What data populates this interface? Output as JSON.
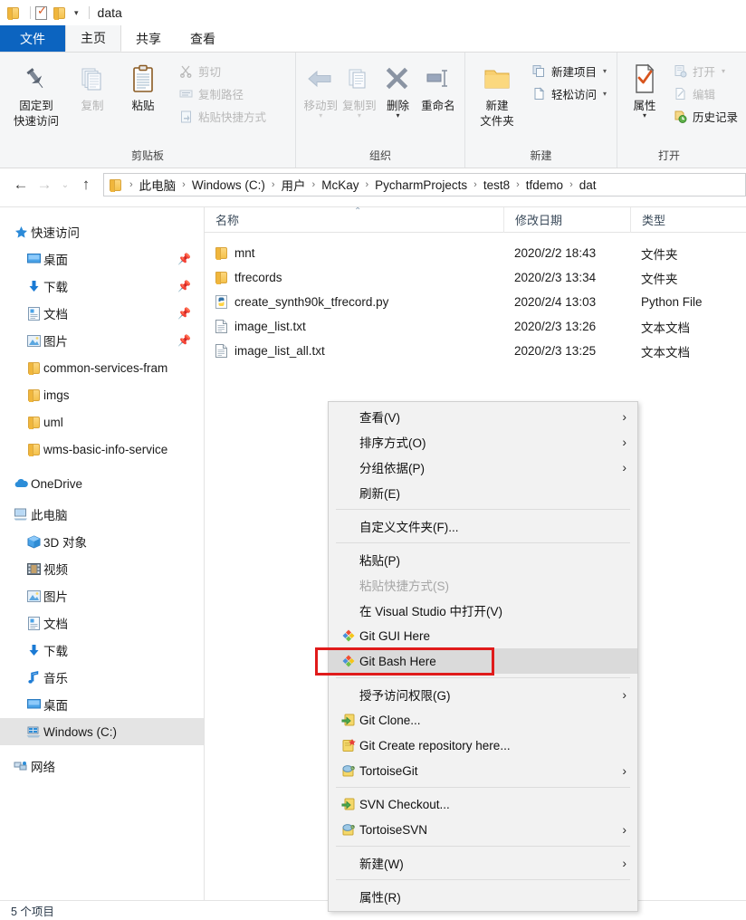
{
  "window": {
    "title": "data",
    "quick_access_icons": [
      "folder-icon",
      "properties-check-icon",
      "folder-icon"
    ],
    "dropdown_caret": "▾"
  },
  "ribbon": {
    "tabs": [
      {
        "label": "文件",
        "state": "file"
      },
      {
        "label": "主页",
        "state": "active"
      },
      {
        "label": "共享",
        "state": "normal"
      },
      {
        "label": "查看",
        "state": "normal"
      }
    ],
    "groups": [
      {
        "title": "剪贴板",
        "big_buttons": [
          {
            "label": "固定到\n快速访问",
            "line1": "固定到",
            "line2": "快速访问",
            "icon": "pin-icon"
          },
          {
            "label": "复制",
            "line1": "复制",
            "line2": "",
            "icon": "copy-icon",
            "dim": true
          },
          {
            "label": "粘贴",
            "line1": "粘贴",
            "line2": "",
            "icon": "paste-clipboard-icon"
          }
        ],
        "small_buttons": [
          {
            "label": "剪切",
            "icon": "scissors-icon",
            "dim": true
          },
          {
            "label": "复制路径",
            "icon": "copy-path-icon",
            "dim": true
          },
          {
            "label": "粘贴快捷方式",
            "icon": "paste-shortcut-icon",
            "dim": true
          }
        ]
      },
      {
        "title": "组织",
        "big_buttons": [
          {
            "line1": "移动到",
            "line2": "",
            "icon": "move-to-arrow-icon",
            "dim": true,
            "caret": "▾"
          },
          {
            "line1": "复制到",
            "line2": "",
            "icon": "copy-to-icon",
            "dim": true,
            "caret": "▾"
          },
          {
            "line1": "删除",
            "line2": "",
            "icon": "delete-x-icon",
            "caret": "▾"
          },
          {
            "line1": "重命名",
            "line2": "",
            "icon": "rename-icon"
          }
        ],
        "small_buttons": []
      },
      {
        "title": "新建",
        "big_buttons": [
          {
            "line1": "新建",
            "line2": "文件夹",
            "icon": "new-folder-icon"
          }
        ],
        "small_buttons": [
          {
            "label": "新建项目",
            "icon": "new-item-icon",
            "caret": "▾"
          },
          {
            "label": "轻松访问",
            "icon": "easy-access-icon",
            "caret": "▾"
          }
        ]
      },
      {
        "title": "打开",
        "big_buttons": [
          {
            "line1": "属性",
            "line2": "",
            "icon": "properties-check-icon",
            "caret": "▾"
          }
        ],
        "small_buttons": [
          {
            "label": "打开",
            "icon": "open-icon",
            "dim": true,
            "caret": "▾"
          },
          {
            "label": "编辑",
            "icon": "edit-icon",
            "dim": true
          },
          {
            "label": "历史记录",
            "icon": "history-icon"
          }
        ]
      }
    ]
  },
  "address_bar": {
    "back_icon": "arrow-left-icon",
    "forward_icon": "arrow-right-icon",
    "recent_icon": "chevron-down-icon",
    "up_icon": "arrow-up-icon",
    "breadcrumbs": [
      "此电脑",
      "Windows (C:)",
      "用户",
      "McKay",
      "PycharmProjects",
      "test8",
      "tfdemo",
      "dat"
    ],
    "separator": "›"
  },
  "sidebar": {
    "items": [
      {
        "label": "快速访问",
        "icon": "star-quick-access-icon",
        "level": 0,
        "chevron": "⌄",
        "pinned": false
      },
      {
        "label": "桌面",
        "icon": "desktop-icon",
        "level": 1,
        "pinned": true
      },
      {
        "label": "下载",
        "icon": "download-arrow-icon",
        "level": 1,
        "pinned": true
      },
      {
        "label": "文档",
        "icon": "documents-icon",
        "level": 1,
        "pinned": true
      },
      {
        "label": "图片",
        "icon": "pictures-icon",
        "level": 1,
        "pinned": true
      },
      {
        "label": "common-services-fram",
        "icon": "folder-icon",
        "level": 1,
        "pinned": false
      },
      {
        "label": "imgs",
        "icon": "folder-icon",
        "level": 1,
        "pinned": false
      },
      {
        "label": "uml",
        "icon": "folder-icon",
        "level": 1,
        "pinned": false
      },
      {
        "label": "wms-basic-info-service",
        "icon": "folder-icon",
        "level": 1,
        "pinned": false
      },
      {
        "label": "OneDrive",
        "icon": "onedrive-cloud-icon",
        "level": 0,
        "pinned": false
      },
      {
        "label": "此电脑",
        "icon": "this-pc-icon",
        "level": 0,
        "chevron": "⌄",
        "pinned": false
      },
      {
        "label": "3D 对象",
        "icon": "3d-objects-icon",
        "level": 1,
        "pinned": false
      },
      {
        "label": "视频",
        "icon": "videos-icon",
        "level": 1,
        "pinned": false
      },
      {
        "label": "图片",
        "icon": "pictures-icon",
        "level": 1,
        "pinned": false
      },
      {
        "label": "文档",
        "icon": "documents-icon",
        "level": 1,
        "pinned": false
      },
      {
        "label": "下载",
        "icon": "download-arrow-icon",
        "level": 1,
        "pinned": false
      },
      {
        "label": "音乐",
        "icon": "music-note-icon",
        "level": 1,
        "pinned": false
      },
      {
        "label": "桌面",
        "icon": "desktop-icon",
        "level": 1,
        "pinned": false
      },
      {
        "label": "Windows (C:)",
        "icon": "drive-icon",
        "level": 1,
        "pinned": false,
        "selected": true
      },
      {
        "label": "网络",
        "icon": "network-icon",
        "level": 0,
        "pinned": false
      }
    ]
  },
  "file_list": {
    "columns": [
      {
        "label": "名称",
        "sorted": true,
        "sort_indicator": "⌃"
      },
      {
        "label": "修改日期",
        "sorted": false
      },
      {
        "label": "类型",
        "sorted": false
      }
    ],
    "rows": [
      {
        "name": "mnt",
        "date": "2020/2/2 18:43",
        "type": "文件夹",
        "icon": "folder-icon"
      },
      {
        "name": "tfrecords",
        "date": "2020/2/3 13:34",
        "type": "文件夹",
        "icon": "folder-icon"
      },
      {
        "name": "create_synth90k_tfrecord.py",
        "date": "2020/2/4 13:03",
        "type": "Python File",
        "icon": "python-file-icon"
      },
      {
        "name": "image_list.txt",
        "date": "2020/2/3 13:26",
        "type": "文本文档",
        "icon": "text-file-icon"
      },
      {
        "name": "image_list_all.txt",
        "date": "2020/2/3 13:25",
        "type": "文本文档",
        "icon": "text-file-icon"
      }
    ]
  },
  "context_menu": {
    "items": [
      {
        "label": "查看(V)",
        "submenu": true,
        "icon": null
      },
      {
        "label": "排序方式(O)",
        "submenu": true,
        "icon": null
      },
      {
        "label": "分组依据(P)",
        "submenu": true,
        "icon": null
      },
      {
        "label": "刷新(E)",
        "submenu": false,
        "icon": null
      },
      {
        "separator": true
      },
      {
        "label": "自定义文件夹(F)...",
        "submenu": false,
        "icon": null
      },
      {
        "separator": true
      },
      {
        "label": "粘贴(P)",
        "submenu": false,
        "icon": null
      },
      {
        "label": "粘贴快捷方式(S)",
        "submenu": false,
        "icon": null,
        "disabled": true
      },
      {
        "label": "在 Visual Studio 中打开(V)",
        "submenu": false,
        "icon": null
      },
      {
        "label": "Git GUI Here",
        "submenu": false,
        "icon": "git-diamond-icon"
      },
      {
        "label": "Git Bash Here",
        "submenu": false,
        "icon": "git-diamond-icon",
        "highlighted": true
      },
      {
        "separator": true
      },
      {
        "label": "授予访问权限(G)",
        "submenu": true,
        "icon": null
      },
      {
        "label": "Git Clone...",
        "submenu": false,
        "icon": "git-clone-icon"
      },
      {
        "label": "Git Create repository here...",
        "submenu": false,
        "icon": "git-create-repo-icon"
      },
      {
        "label": "TortoiseGit",
        "submenu": true,
        "icon": "tortoise-icon"
      },
      {
        "separator": true
      },
      {
        "label": "SVN Checkout...",
        "submenu": false,
        "icon": "svn-checkout-icon"
      },
      {
        "label": "TortoiseSVN",
        "submenu": true,
        "icon": "tortoise-icon"
      },
      {
        "separator": true
      },
      {
        "label": "新建(W)",
        "submenu": true,
        "icon": null
      },
      {
        "separator": true
      },
      {
        "label": "属性(R)",
        "submenu": false,
        "icon": null
      }
    ],
    "submenu_arrow": "›",
    "highlight_color": "#dadada",
    "annotation_color": "#e01b1b"
  },
  "status_bar": {
    "text": "5 个项目"
  }
}
